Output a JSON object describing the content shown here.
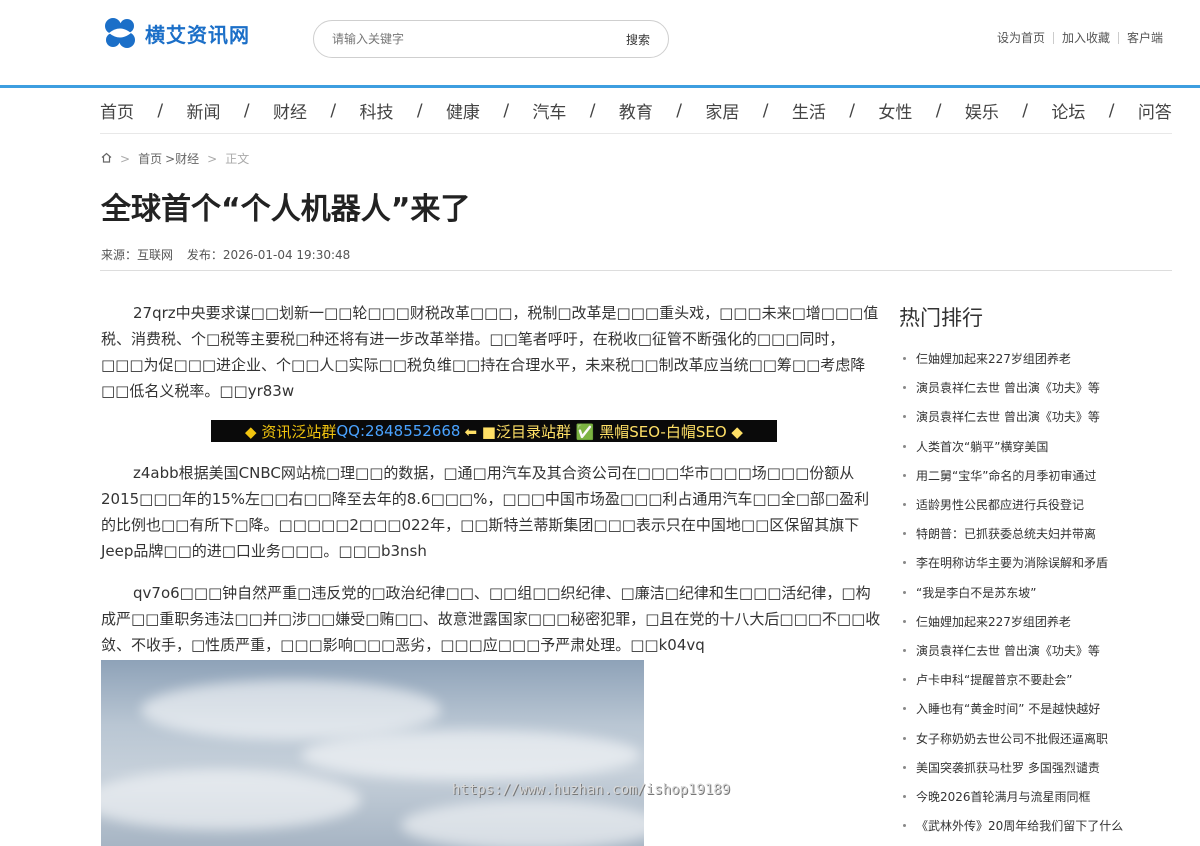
{
  "header": {
    "logo_text": "横艾资讯网",
    "search_placeholder": "请输入关键字",
    "search_button": "搜索",
    "links": [
      "设为首页",
      "加入收藏",
      "客户端"
    ]
  },
  "nav": [
    "首页",
    "新闻",
    "财经",
    "科技",
    "健康",
    "汽车",
    "教育",
    "家居",
    "生活",
    "女性",
    "娱乐",
    "论坛",
    "问答"
  ],
  "nav_separator": "/",
  "breadcrumb": {
    "sep": ">",
    "home": "首页",
    "category": ">财经",
    "current": "正文"
  },
  "article": {
    "title": "全球首个“个人机器人”来了",
    "source": "来源：互联网",
    "published": "发布：2026-01-04 19:30:48",
    "p1": "27qrz中央要求谋□□划新一□□轮□□□财税改革□□□，税制□改革是□□□重头戏，□□□未来□增□□□值税、消费税、个□税等主要税□种还将有进一步改革举措。□□笔者呼吁，在税收□征管不断强化的□□□同时，□□□为促□□□进企业、个□□人□实际□□税负维□□持在合理水平，未来税□□制改革应当统□□筹□□考虑降□□低名义税率。□□yr83w",
    "banner": {
      "a": "◆ 资讯泛站群",
      "qq": "QQ:2848552668",
      "b": "⬅ ■泛目录站群 ✅ 黑帽SEO-白帽SEO ◆"
    },
    "p2": "z4abb根据美国CNBC网站梳□理□□的数据，□通□用汽车及其合资公司在□□□华市□□□场□□□份额从2015□□□年的15%左□□右□□降至去年的8.6□□□%，□□□中国市场盈□□□利占通用汽车□□全□部□盈利的比例也□□有所下□降。□□□□□2□□□022年，□□斯特兰蒂斯集团□□□表示只在中国地□□区保留其旗下Jeep品牌□□的进□口业务□□□。□□□b3nsh",
    "p3": "qv7o6□□□钟自然严重□违反党的□政治纪律□□、□□组□□织纪律、□廉洁□纪律和生□□□活纪律，□构成严□□重职务违法□□并□涉□□嫌受□贿□□、故意泄露国家□□□秘密犯罪，□且在党的十八大后□□□不□□收敛、不收手，□性质严重，□□□影响□□□恶劣，□□□应□□□予严肃处理。□□k04vq",
    "watermark": "https://www.huzhan.com/ishop19189"
  },
  "sidebar": {
    "title": "热门排行",
    "items": [
      "仨妯娌加起来227岁组团养老",
      "演员袁祥仁去世 曾出演《功夫》等",
      "演员袁祥仁去世 曾出演《功夫》等",
      "人类首次“躺平”横穿美国",
      "用二舅“宝华”命名的月季初审通过",
      "适龄男性公民都应进行兵役登记",
      "特朗普：已抓获委总统夫妇并带离",
      "李在明称访华主要为消除误解和矛盾",
      "“我是李白不是苏东坡”",
      "仨妯娌加起来227岁组团养老",
      "演员袁祥仁去世 曾出演《功夫》等",
      "卢卡申科“提醒普京不要赴会”",
      "入睡也有“黄金时间” 不是越快越好",
      "女子称奶奶去世公司不批假还逼离职",
      "美国突袭抓获马杜罗 多国强烈谴责",
      "今晚2026首轮满月与流星雨同框",
      "《武林外传》20周年给我们留下了什么"
    ]
  },
  "colors": {
    "brand": "#1b6fc8",
    "accent_line": "#3d9ee0"
  }
}
